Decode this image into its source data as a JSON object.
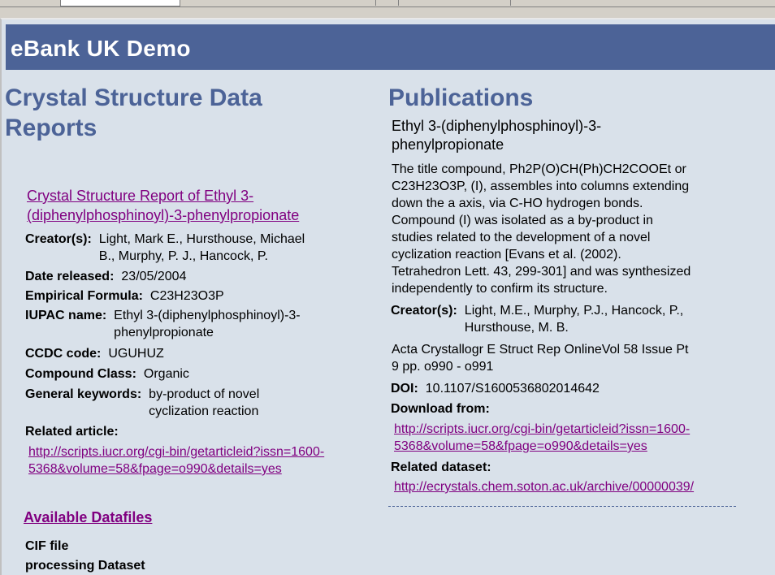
{
  "banner": {
    "title": "eBank UK Demo"
  },
  "left": {
    "heading_line1": "Crystal Structure Data",
    "heading_line2": "Reports",
    "report": {
      "title_line1": "Crystal Structure Report of Ethyl 3-",
      "title_line2": "(diphenylphosphinoyl)-3-phenylpropionate",
      "fields": {
        "creators_label": "Creator(s):",
        "creators_line1": "Light, Mark E., Hursthouse, Michael",
        "creators_line2": "B., Murphy, P. J., Hancock, P.",
        "date_label": "Date released:",
        "date_value": "23/05/2004",
        "formula_label": "Empirical Formula:",
        "formula_value": "C23H23O3P",
        "iupac_label": "IUPAC name:",
        "iupac_line1": "Ethyl 3-(diphenylphosphinoyl)-3-",
        "iupac_line2": "phenylpropionate",
        "ccdc_label": "CCDC code:",
        "ccdc_value": "UGUHUZ",
        "class_label": "Compound Class:",
        "class_value": "Organic",
        "keywords_label": "General keywords:",
        "keywords_line1": "by-product of novel",
        "keywords_line2": "cyclization reaction",
        "related_label": "Related article:",
        "related_link_line1": "http://scripts.iucr.org/cgi-bin/getarticleid?issn=1600-",
        "related_link_line2": "5368&volume=58&fpage=o990&details=yes"
      }
    },
    "datafiles": {
      "heading": "Available Datafiles",
      "items": [
        "CIF file",
        "processing Dataset"
      ]
    }
  },
  "right": {
    "heading": "Publications",
    "pub_title_line1": "Ethyl 3-(diphenylphosphinoyl)-3-",
    "pub_title_line2": "phenylpropionate",
    "abstract_lines": [
      "The title compound, Ph2P(O)CH(Ph)CH2COOEt or",
      "C23H23O3P, (I), assembles into columns extending",
      "down the a axis, via C-HO hydrogen bonds.",
      "Compound (I) was isolated as a by-product in",
      "studies related to the development of a novel",
      "cyclization reaction [Evans et al. (2002).",
      "Tetrahedron Lett. 43, 299-301] and was synthesized",
      "independently to confirm its structure."
    ],
    "creators_label": "Creator(s):",
    "creators_line1": "Light, M.E., Murphy, P.J., Hancock, P.,",
    "creators_line2": "Hursthouse, M. B.",
    "journal_line1": "Acta Crystallogr E Struct Rep OnlineVol 58 Issue Pt",
    "journal_line2": "9 pp. o990 - o991",
    "doi_label": "DOI:",
    "doi_value": "10.1107/S1600536802014642",
    "download_label": "Download from:",
    "download_line1": "http://scripts.iucr.org/cgi-bin/getarticleid?issn=1600-",
    "download_line2": "5368&volume=58&fpage=o990&details=yes",
    "dataset_label": "Related dataset:",
    "dataset_link": "http://ecrystals.chem.soton.ac.uk/archive/00000039/"
  },
  "colors": {
    "banner": "#4c6397",
    "heading": "#4c6397",
    "link": "#800080",
    "page_bg": "#d9e1ea"
  }
}
